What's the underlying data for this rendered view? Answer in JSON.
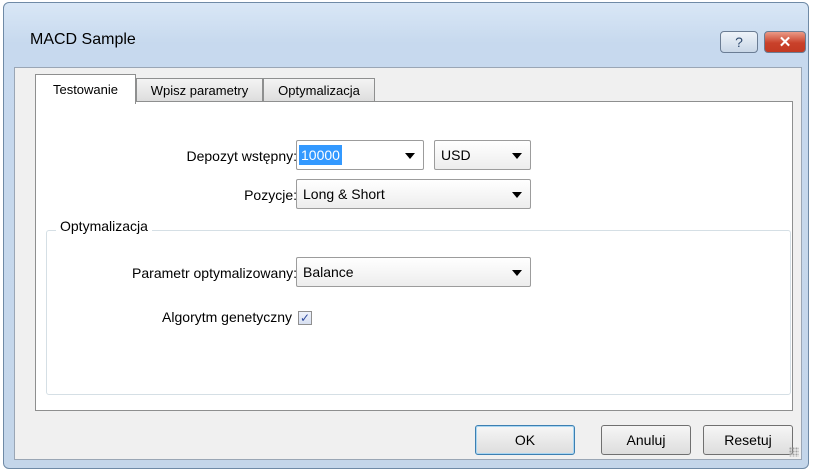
{
  "window": {
    "title": "MACD Sample",
    "help_label": "?",
    "close_label": "✕"
  },
  "tabs": [
    {
      "label": "Testowanie",
      "active": true
    },
    {
      "label": "Wpisz parametry",
      "active": false
    },
    {
      "label": "Optymalizacja",
      "active": false
    }
  ],
  "deposit": {
    "label": "Depozyt wstępny:",
    "value": "10000",
    "currency": "USD"
  },
  "positions": {
    "label": "Pozycje:",
    "value": "Long & Short"
  },
  "optimization": {
    "group_title": "Optymalizacja",
    "param_label": "Parametr optymalizowany:",
    "param_value": "Balance",
    "genetic_label": "Algorytm genetyczny",
    "genetic_checked": true
  },
  "buttons": {
    "ok": "OK",
    "cancel": "Anuluj",
    "reset": "Resetuj"
  },
  "icons": {
    "help": "question-icon",
    "close": "close-icon",
    "dropdown": "chevron-down-icon",
    "check": "checkmark-icon"
  }
}
